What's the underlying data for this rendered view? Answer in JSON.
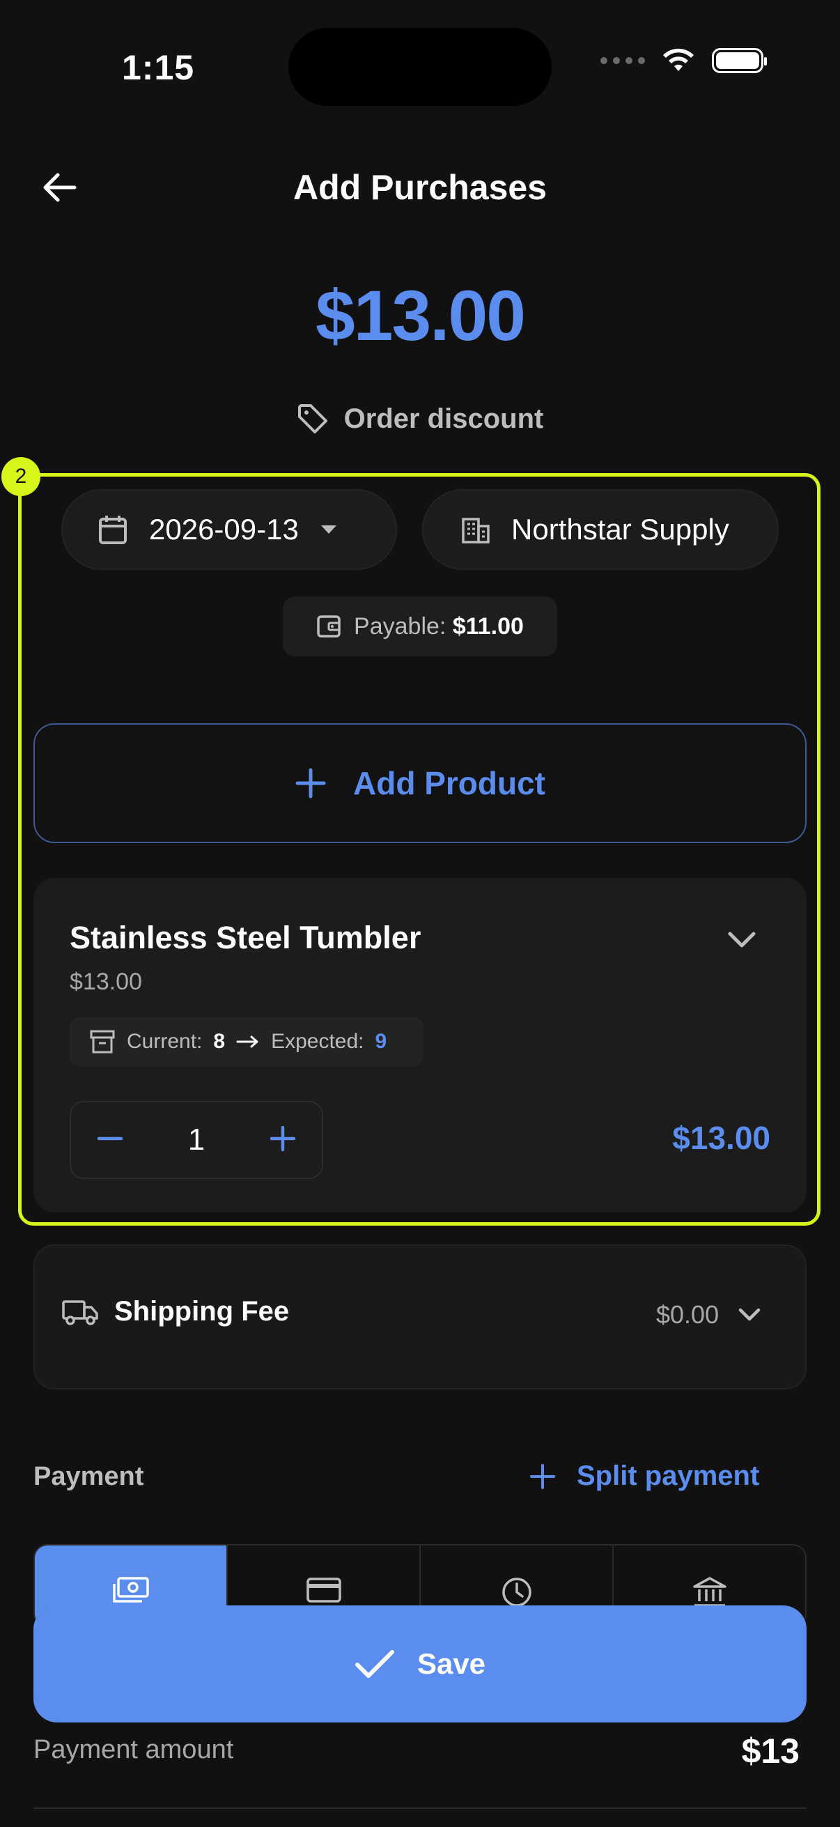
{
  "status_bar": {
    "time": "1:15"
  },
  "header": {
    "title": "Add Purchases"
  },
  "summary": {
    "total": "$13.00",
    "discount_label": "Order discount"
  },
  "highlight": {
    "badge": "2"
  },
  "filters": {
    "date": "2026-09-13",
    "vendor": "Northstar Supply"
  },
  "payable": {
    "label": "Payable:",
    "amount": "$11.00"
  },
  "add_product": {
    "label": "Add Product"
  },
  "product": {
    "name": "Stainless Steel Tumbler",
    "price": "$13.00",
    "current_label": "Current:",
    "current": "8",
    "expected_label": "Expected:",
    "expected": "9",
    "quantity": "1",
    "line_total": "$13.00"
  },
  "shipping": {
    "label": "Shipping Fee",
    "value": "$0.00"
  },
  "payment": {
    "heading": "Payment",
    "split_label": "Split payment",
    "methods": [
      "cash-icon",
      "card-icon",
      "clock-icon",
      "bank-icon"
    ],
    "active_method": 0,
    "amount_label": "Payment amount",
    "amount": "$13"
  },
  "save_button": {
    "label": "Save"
  },
  "colors": {
    "accent": "#5b8def",
    "highlight": "#d8f51a",
    "background": "#111111"
  }
}
